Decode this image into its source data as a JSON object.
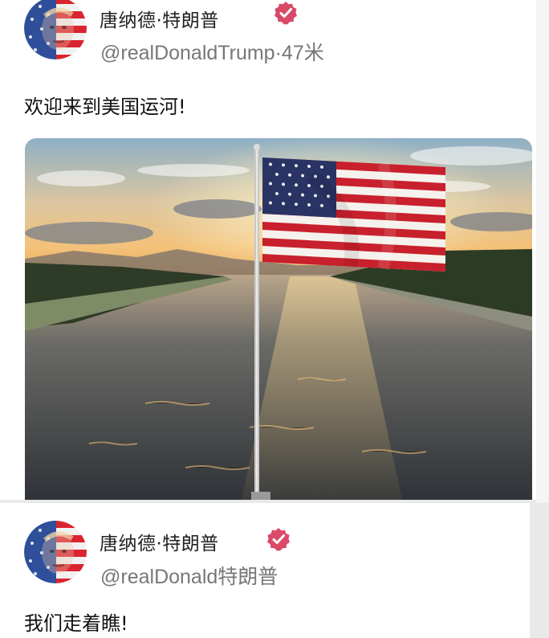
{
  "posts": [
    {
      "display_name": "唐纳德·特朗普",
      "handle_time": "@realDonaldTrump·47米",
      "verified_icon": "verified-badge-icon",
      "text": "欢迎来到美国运河!",
      "image": {
        "description_icon": "flag-over-canal-photo"
      }
    },
    {
      "display_name": "唐纳德·特朗普",
      "handle_time": "@realDonald特朗普",
      "verified_icon": "verified-badge-icon",
      "text": "我们走着瞧!"
    }
  ],
  "colors": {
    "verified_badge": "#d94a68",
    "handle_text": "#777777",
    "background": "#ffffff"
  }
}
